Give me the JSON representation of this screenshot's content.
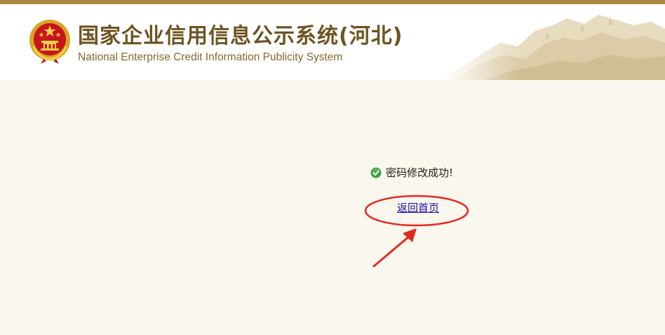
{
  "header": {
    "title_cn": "国家企业信用信息公示系统(河北)",
    "title_en": "National Enterprise Credit Information Publicity System",
    "emblem_icon": "national-emblem-icon"
  },
  "main": {
    "success_icon": "check-circle-icon",
    "success_text": "密码修改成功!",
    "home_link_label": "返回首页"
  },
  "colors": {
    "top_bar": "#a8873f",
    "page_background": "#faf7ee",
    "title_brown": "#6d5420",
    "success_green": "#3aa03a",
    "link_blue": "#1a0dab",
    "annotation_red": "#e52a1f"
  }
}
